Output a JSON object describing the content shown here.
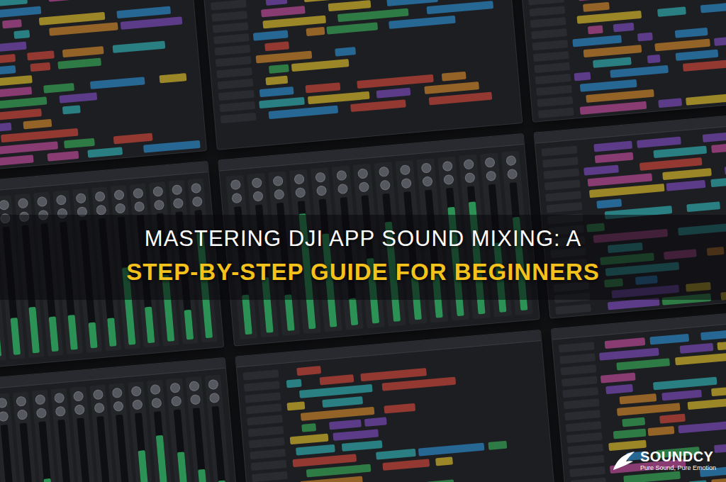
{
  "title": {
    "lines": [
      {
        "text": "MASTERING DJI APP SOUND MIXING: A",
        "color": "#ffffff"
      },
      {
        "text": "STEP-BY-STEP GUIDE FOR BEGINNERS",
        "color": "#f5c21b"
      }
    ]
  },
  "logo": {
    "name": "SOUNDCY",
    "tagline": "Pure Sound, Pure Emotion"
  }
}
